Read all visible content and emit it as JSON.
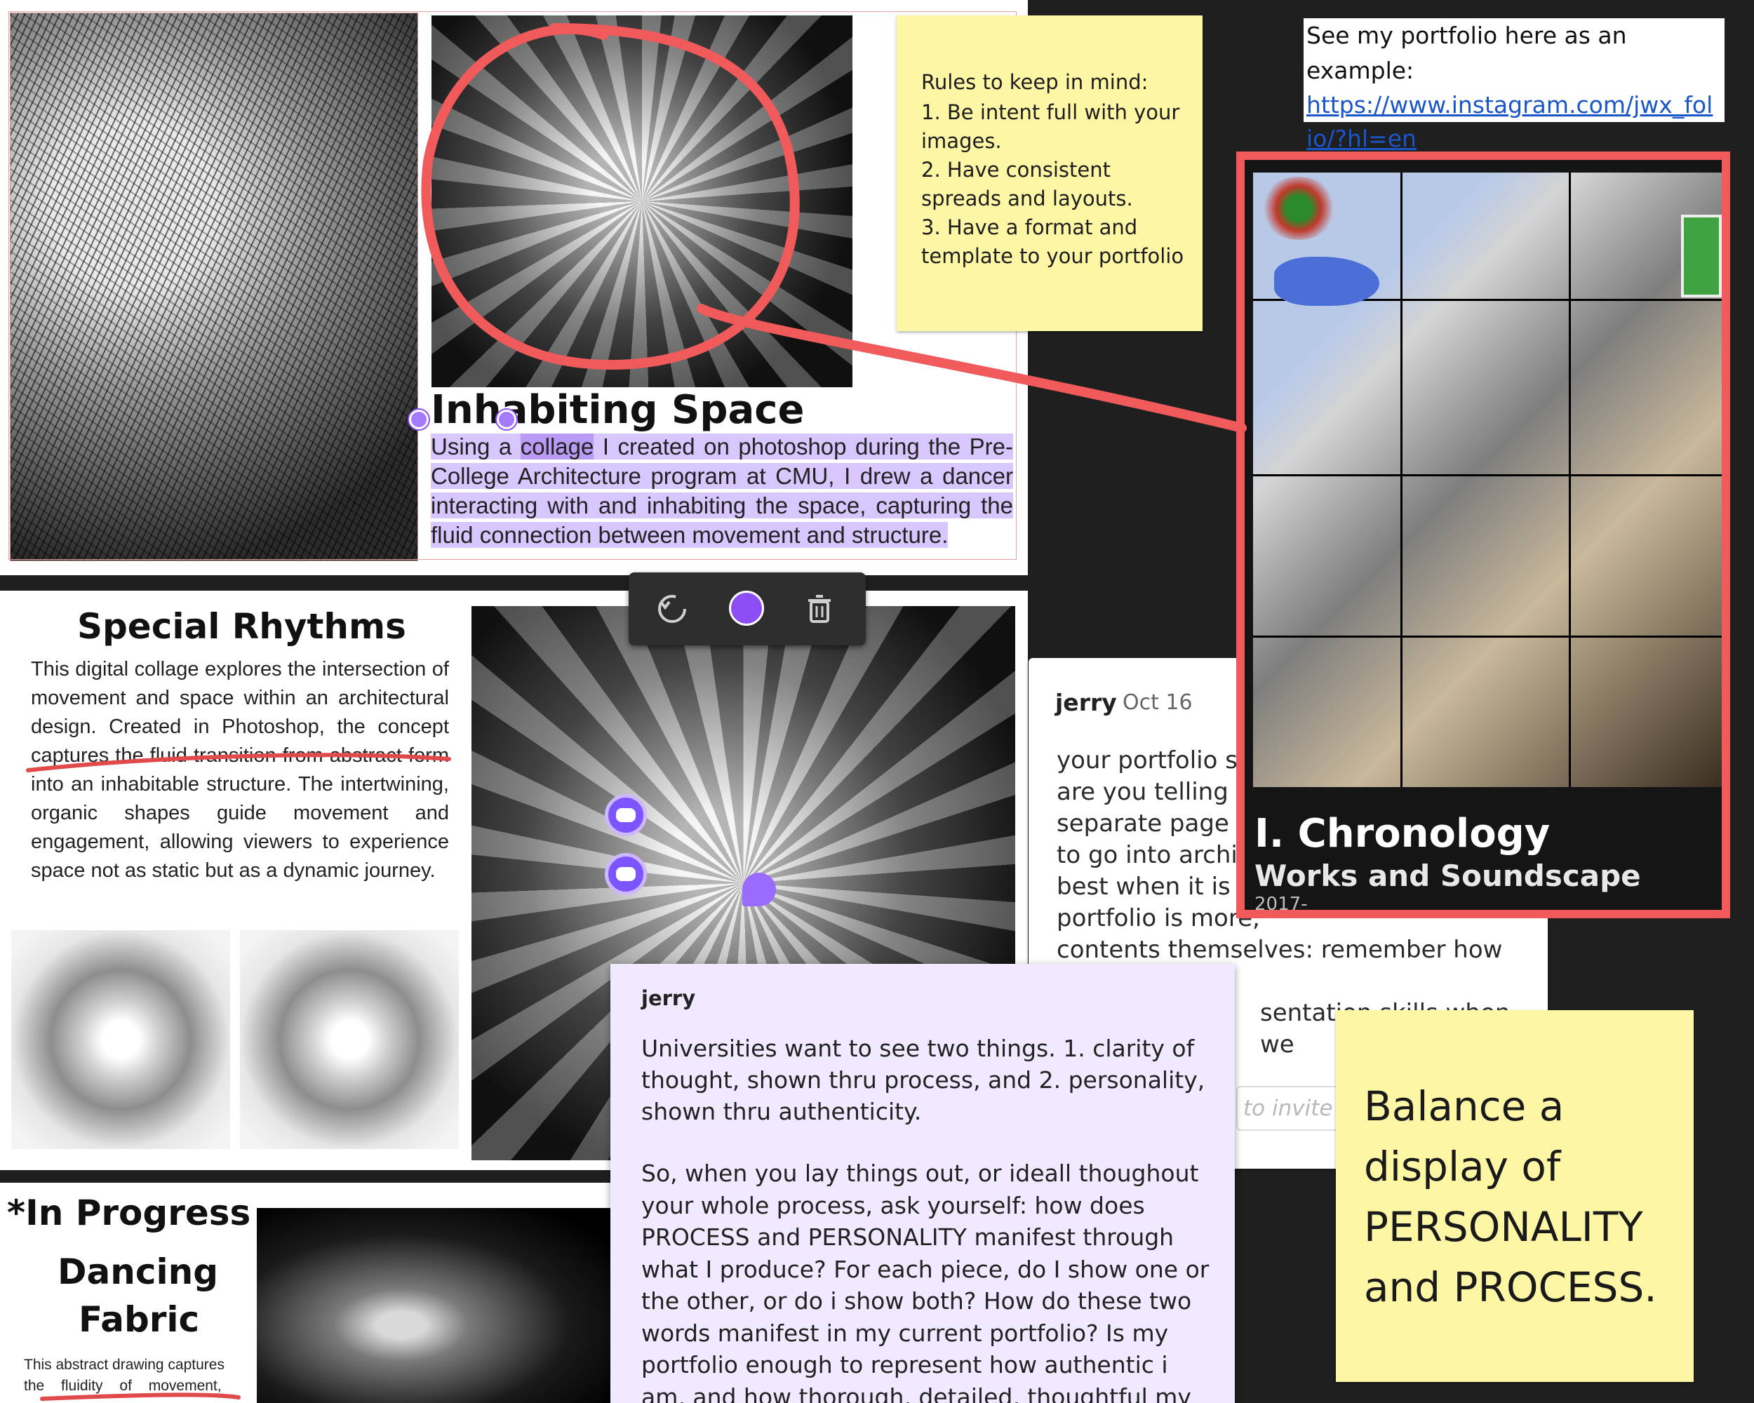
{
  "inhabiting": {
    "title": "Inhabiting Space",
    "desc_pre": "Using a ",
    "desc_word": "collage",
    "desc_post": " I created on photoshop during the Pre-College Architecture program at CMU, I drew a dancer interacting with and inhabiting the space, capturing the fluid connection between movement and structure."
  },
  "rhythms": {
    "title": "Special Rhythms",
    "desc": "This digital collage explores the intersection of movement and space within an architectural design. Created in Photoshop, the concept captures the fluid transition from abstract form into an inhabitable structure. The intertwining, organic shapes guide movement and engagement, allowing viewers to experience space not as static but as a dynamic journey."
  },
  "progress": {
    "tag": "*In Progress",
    "title_line1": "Dancing",
    "title_line2": "Fabric",
    "desc_line1": "This abstract drawing captures",
    "desc_line2": "the fluidity of movement,"
  },
  "rules_note": {
    "header": "Rules to keep in mind:",
    "items": [
      "1. Be intent full with your images.",
      "2. Have consistent spreads and layouts.",
      "3. Have a format and template to your portfolio"
    ]
  },
  "portfolio_note": {
    "text": "See my portfolio here as an example:",
    "link": "https://www.instagram.com/jwx_folio/?hl=en"
  },
  "chronology": {
    "title": "I. Chronology",
    "subtitle": "Works and Soundscape",
    "year": "2017-"
  },
  "toolbar": {
    "undo_icon": "undo-icon",
    "color": "#8c4df5",
    "delete_icon": "trash-icon"
  },
  "comment1": {
    "author": "jerry",
    "date": "Oct 16",
    "lines": [
      "your portfolio sho",
      "are you telling he",
      "separate page fo",
      "to go into archite",
      "best when it is OF",
      "portfolio is more,",
      "contents themselves: remember how much",
      "sentation skills when we"
    ],
    "invite_placeholder": "to invite o"
  },
  "comment2": {
    "author": "jerry",
    "para1": "Universities want to see two things. 1. clarity of thought, shown thru process, and 2. personality, shown thru authenticity.",
    "para2": "So, when you lay things out, or ideall thoughout your whole process, ask yourself: how does PROCESS and PERSONALITY manifest through what I produce? For each piece, do I show one or the other, or do i show both? How do these two words manifest in my current portfolio? Is my portfolio enough to represent how authentic i am, and how thorough, detailed, thoughtful my process is (bc you are authentic and"
  },
  "balance_note": {
    "text": "Balance a display of PERSONALITY and PROCESS."
  },
  "colors": {
    "annotation_red": "#f05a5a",
    "highlight_purple": "#d8c6ff",
    "sticky_yellow": "#fdf6a5",
    "comment_purple": "#f1e9ff"
  }
}
